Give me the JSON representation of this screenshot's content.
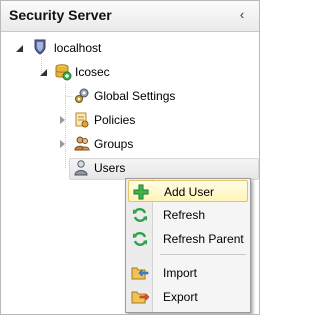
{
  "panel": {
    "title": "Security Server",
    "collapse_glyph": "‹"
  },
  "tree": {
    "root": {
      "label": "localhost",
      "icon": "server-shield-icon"
    },
    "db": {
      "label": "Icosec",
      "icon": "database-icon"
    },
    "children": [
      {
        "label": "Global Settings",
        "icon": "gears-icon"
      },
      {
        "label": "Policies",
        "icon": "policies-icon"
      },
      {
        "label": "Groups",
        "icon": "groups-icon"
      },
      {
        "label": "Users",
        "icon": "users-icon"
      }
    ]
  },
  "context_menu": {
    "items": [
      {
        "label": "Add User",
        "icon": "add-plus-icon"
      },
      {
        "label": "Refresh",
        "icon": "refresh-icon"
      },
      {
        "label": "Refresh Parent",
        "icon": "refresh-icon"
      },
      {
        "label": "Import",
        "icon": "import-folder-icon"
      },
      {
        "label": "Export",
        "icon": "export-folder-icon"
      }
    ]
  },
  "colors": {
    "hover_bg": "#fff4b8",
    "hover_border": "#e5c365",
    "green_icon": "#2fa34a",
    "folder": "#e8b84a"
  }
}
